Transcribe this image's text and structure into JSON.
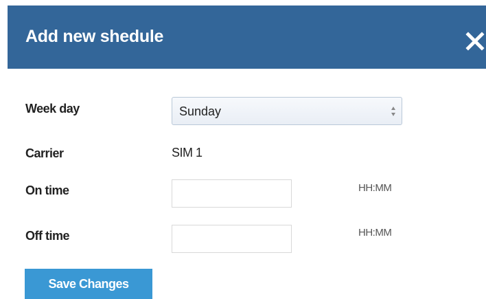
{
  "dialog": {
    "title": "Add new shedule",
    "close_icon": "close-icon"
  },
  "form": {
    "week_day": {
      "label": "Week day",
      "selected": "Sunday"
    },
    "carrier": {
      "label": "Carrier",
      "value": "SIM 1"
    },
    "on_time": {
      "label": "On time",
      "value": "",
      "hint": "HH:MM"
    },
    "off_time": {
      "label": "Off time",
      "value": "",
      "hint": "HH:MM"
    }
  },
  "actions": {
    "save_label": "Save Changes"
  },
  "colors": {
    "header_bg": "#336699",
    "button_bg": "#3a98d4"
  }
}
